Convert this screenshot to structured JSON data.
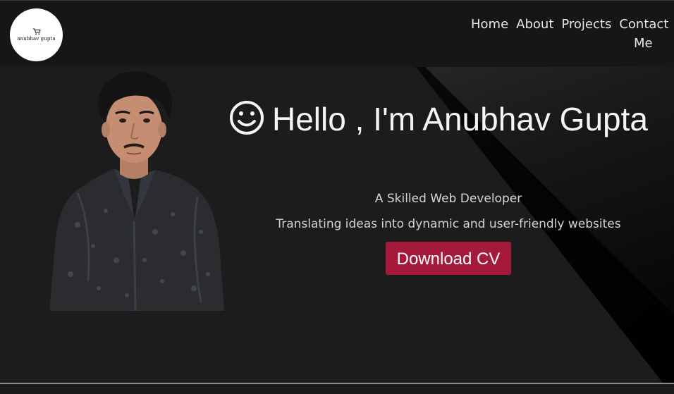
{
  "logo": {
    "icon": "cart-icon",
    "text": "anubhav gupta"
  },
  "nav": {
    "items": [
      {
        "label": "Home"
      },
      {
        "label": "About"
      },
      {
        "label": "Projects"
      },
      {
        "label": "Contact Me"
      }
    ]
  },
  "hero": {
    "smile_icon": "smiley-face-icon",
    "heading": "Hello , I'm Anubhav Gupta",
    "subtitle": "A Skilled Web Developer",
    "tagline": "Translating ideas into dynamic and user-friendly websites",
    "cta_label": "Download CV"
  },
  "colors": {
    "navbar_bg": "#161616",
    "page_bg": "#1c1c1c",
    "cta_bg": "#a51a3b",
    "text": "#ffffff"
  }
}
